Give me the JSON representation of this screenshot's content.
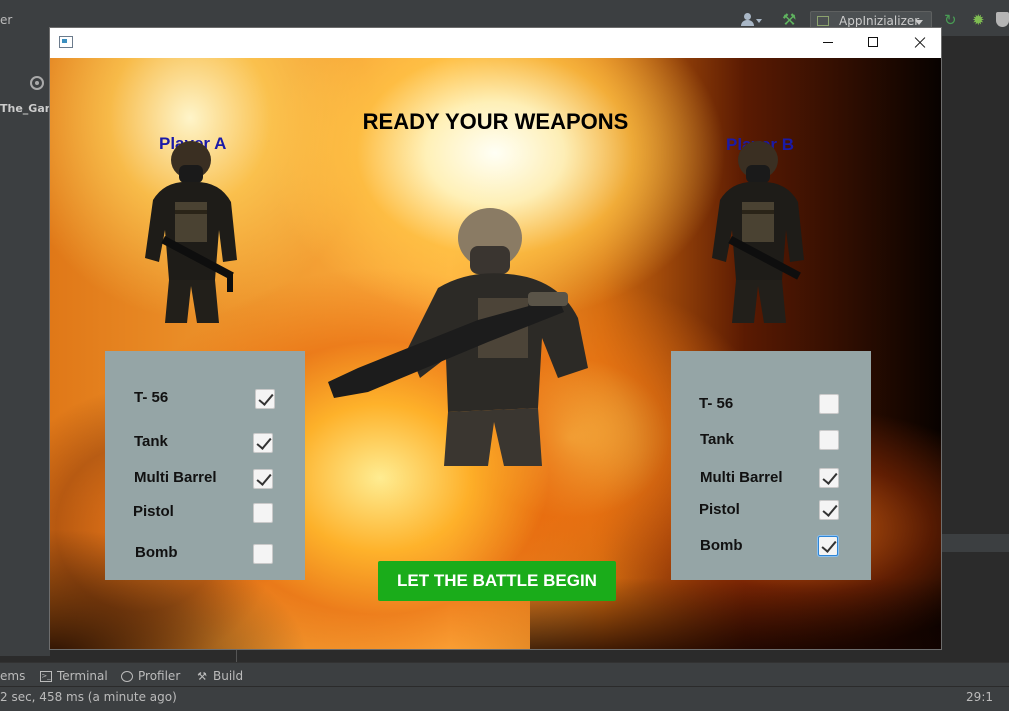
{
  "ide": {
    "title_fragment": "er",
    "project_tab": "The_Game",
    "run_config": "AppInizializer",
    "bottom_tabs": [
      {
        "label": "ems"
      },
      {
        "label": "Terminal"
      },
      {
        "label": "Profiler"
      },
      {
        "label": "Build"
      }
    ],
    "status_message": "2 sec, 458 ms (a minute ago)",
    "cursor_position": "29:1",
    "colors": {
      "bg": "#2b2b2b",
      "panel": "#3c3f41"
    }
  },
  "window": {
    "controls": [
      "minimize-icon",
      "maximize-icon",
      "close-icon"
    ]
  },
  "game": {
    "headline": "READY YOUR WEAPONS",
    "player_a": {
      "label": "Player A",
      "weapons": [
        {
          "label": "T- 56",
          "checked": true
        },
        {
          "label": "Tank",
          "checked": true
        },
        {
          "label": "Multi Barrel",
          "checked": true
        },
        {
          "label": "Pistol",
          "checked": false
        },
        {
          "label": "Bomb",
          "checked": false
        }
      ]
    },
    "player_b": {
      "label": "Player B",
      "weapons": [
        {
          "label": "T- 56",
          "checked": false
        },
        {
          "label": "Tank",
          "checked": false
        },
        {
          "label": "Multi Barrel",
          "checked": true
        },
        {
          "label": "Pistol",
          "checked": true
        },
        {
          "label": "Bomb",
          "checked": true,
          "focused": true
        }
      ]
    },
    "start_button": "LET THE BATTLE BEGIN",
    "colors": {
      "player_label": "#1a1aa8",
      "panel": "#95a5a6",
      "button": "#1aac1a",
      "button_text": "#ffffff"
    }
  }
}
